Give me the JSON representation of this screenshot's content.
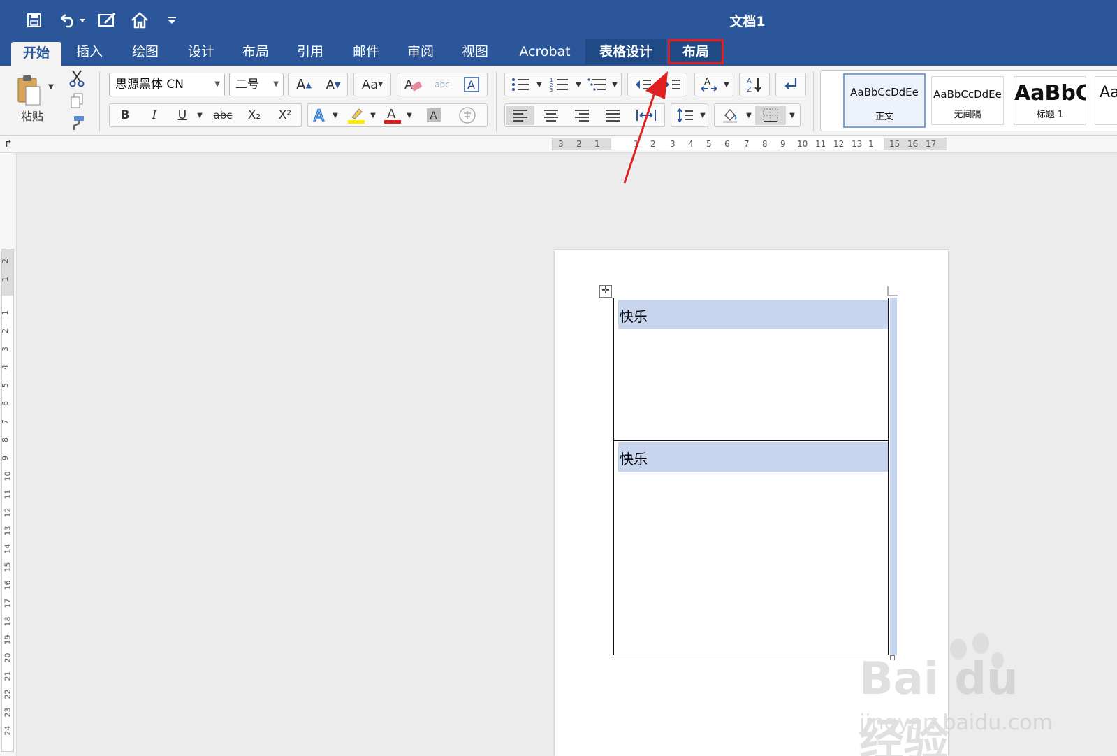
{
  "document_title": "文档1",
  "tabs": [
    {
      "label": "开始",
      "active": true
    },
    {
      "label": "插入"
    },
    {
      "label": "绘图"
    },
    {
      "label": "设计"
    },
    {
      "label": "布局"
    },
    {
      "label": "引用"
    },
    {
      "label": "邮件"
    },
    {
      "label": "审阅"
    },
    {
      "label": "视图"
    },
    {
      "label": "Acrobat"
    },
    {
      "label": "表格设计",
      "contextual": true
    },
    {
      "label": "布局",
      "contextual": true,
      "highlighted": true
    }
  ],
  "ribbon": {
    "paste_label": "粘贴",
    "font_name": "思源黑体 CN",
    "font_size": "二号",
    "bold": "B",
    "italic": "I",
    "underline": "U",
    "strikethrough": "abc",
    "subscript": "X₂",
    "superscript": "X²",
    "styles": [
      {
        "sample": "AaBbCcDdEe",
        "name": "正文",
        "selected": true
      },
      {
        "sample": "AaBbCcDdEe",
        "name": "无间隔"
      },
      {
        "sample": "AaBbC",
        "name": "标题 1"
      },
      {
        "sample": "Aa",
        "name": ""
      }
    ]
  },
  "hruler_numbers": [
    "3",
    "2",
    "1",
    "1",
    "2",
    "3",
    "4",
    "5",
    "6",
    "7",
    "8",
    "9",
    "10",
    "11",
    "12",
    "13",
    "1",
    "15",
    "16",
    "17"
  ],
  "vruler_numbers": [
    "2",
    "1",
    "1",
    "2",
    "3",
    "4",
    "5",
    "6",
    "7",
    "8",
    "9",
    "10",
    "11",
    "12",
    "13",
    "14",
    "15",
    "16",
    "17",
    "18",
    "19",
    "20",
    "21",
    "22",
    "23",
    "24"
  ],
  "table": {
    "rows": [
      {
        "text": "快乐"
      },
      {
        "text": "快乐"
      }
    ]
  },
  "watermark": {
    "brand": "Bai du 经验",
    "url": "jingyan.baidu.com"
  },
  "colors": {
    "title_bar": "#2b579a",
    "highlight_box": "#e02020",
    "cell_selection": "#c8d5ee",
    "annotation_arrow": "#e02020"
  },
  "icons": [
    "save-icon",
    "undo-icon",
    "edit-icon",
    "home-icon",
    "customize-icon",
    "cut-icon",
    "copy-icon",
    "format-painter-icon"
  ]
}
